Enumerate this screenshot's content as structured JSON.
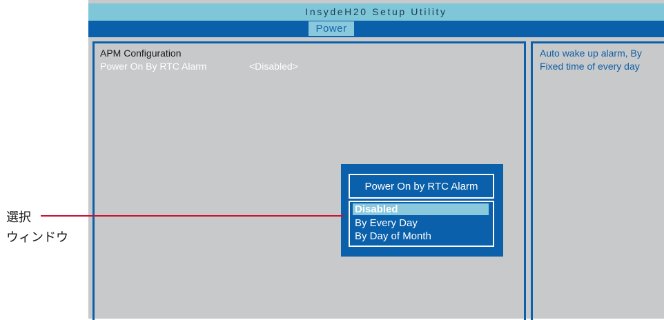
{
  "app": {
    "title": "InsydeH20 Setup Utility"
  },
  "menu": {
    "tabs": [
      {
        "label": "Power",
        "active": true
      }
    ]
  },
  "main": {
    "section_title": "APM Configuration",
    "settings": [
      {
        "name": "Power On By RTC Alarm",
        "value": "<Disabled>"
      }
    ]
  },
  "help": {
    "lines": [
      "Auto wake up alarm, By",
      "Fixed time of every day"
    ]
  },
  "popup": {
    "title": "Power On by RTC Alarm",
    "options": [
      {
        "label": "Disabled",
        "selected": true
      },
      {
        "label": "By Every Day",
        "selected": false
      },
      {
        "label": "By Day of Month",
        "selected": false
      }
    ]
  },
  "annotation": {
    "line1": "選択",
    "line2": "ウィンドウ"
  },
  "colors": {
    "bios_background": "#c8c9ca",
    "title_bar": "#7fc6d9",
    "menu_bar": "#0a60aa",
    "highlight": "#8ac9dd",
    "annotation_line": "#c8102e"
  }
}
